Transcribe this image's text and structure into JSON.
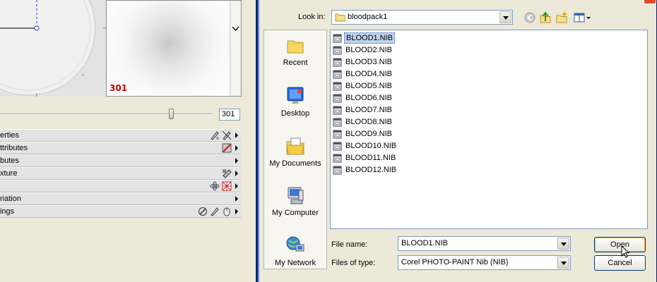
{
  "left_panel": {
    "tip_number": "301",
    "slider_value": "301",
    "properties": [
      {
        "label": "erties",
        "icons": [
          "pen-eye-icon",
          "pen-cross-icon"
        ]
      },
      {
        "label": "ttributes",
        "icons": [
          "gradient-pen-icon"
        ]
      },
      {
        "label": "butes",
        "icons": []
      },
      {
        "label": "xture",
        "icons": [
          "texture-pen-icon"
        ]
      },
      {
        "label": "",
        "icons": [
          "atom-icon",
          "grid-target-icon"
        ]
      },
      {
        "label": "riation",
        "icons": []
      },
      {
        "label": "ings",
        "icons": [
          "no-entry-icon",
          "brush-icon",
          "mouse-icon"
        ]
      }
    ]
  },
  "dialog": {
    "look_in_label": "Look in:",
    "look_in_value": "bloodpack1",
    "places": [
      {
        "label": "Recent",
        "icon": "recent-folder-icon"
      },
      {
        "label": "Desktop",
        "icon": "desktop-icon"
      },
      {
        "label": "My Documents",
        "icon": "my-documents-icon"
      },
      {
        "label": "My Computer",
        "icon": "my-computer-icon"
      },
      {
        "label": "My Network",
        "icon": "my-network-icon"
      }
    ],
    "files": [
      "BLOOD1.NIB",
      "BLOOD2.NIB",
      "BLOOD3.NIB",
      "BLOOD4.NIB",
      "BLOOD5.NIB",
      "BLOOD6.NIB",
      "BLOOD7.NIB",
      "BLOOD8.NIB",
      "BLOOD9.NIB",
      "BLOOD10.NIB",
      "BLOOD11.NIB",
      "BLOOD12.NIB"
    ],
    "selected_file": "BLOOD1.NIB",
    "file_name_label": "File name:",
    "file_name_value": "BLOOD1.NIB",
    "file_type_label": "Files of type:",
    "file_type_value": "Corel PHOTO-PAINT Nib (NIB)",
    "open_label": "Open",
    "cancel_label": "Cancel"
  },
  "colors": {
    "accent": "#0a246a",
    "selection": "#c1d2ee",
    "tip_number": "#c00000"
  }
}
